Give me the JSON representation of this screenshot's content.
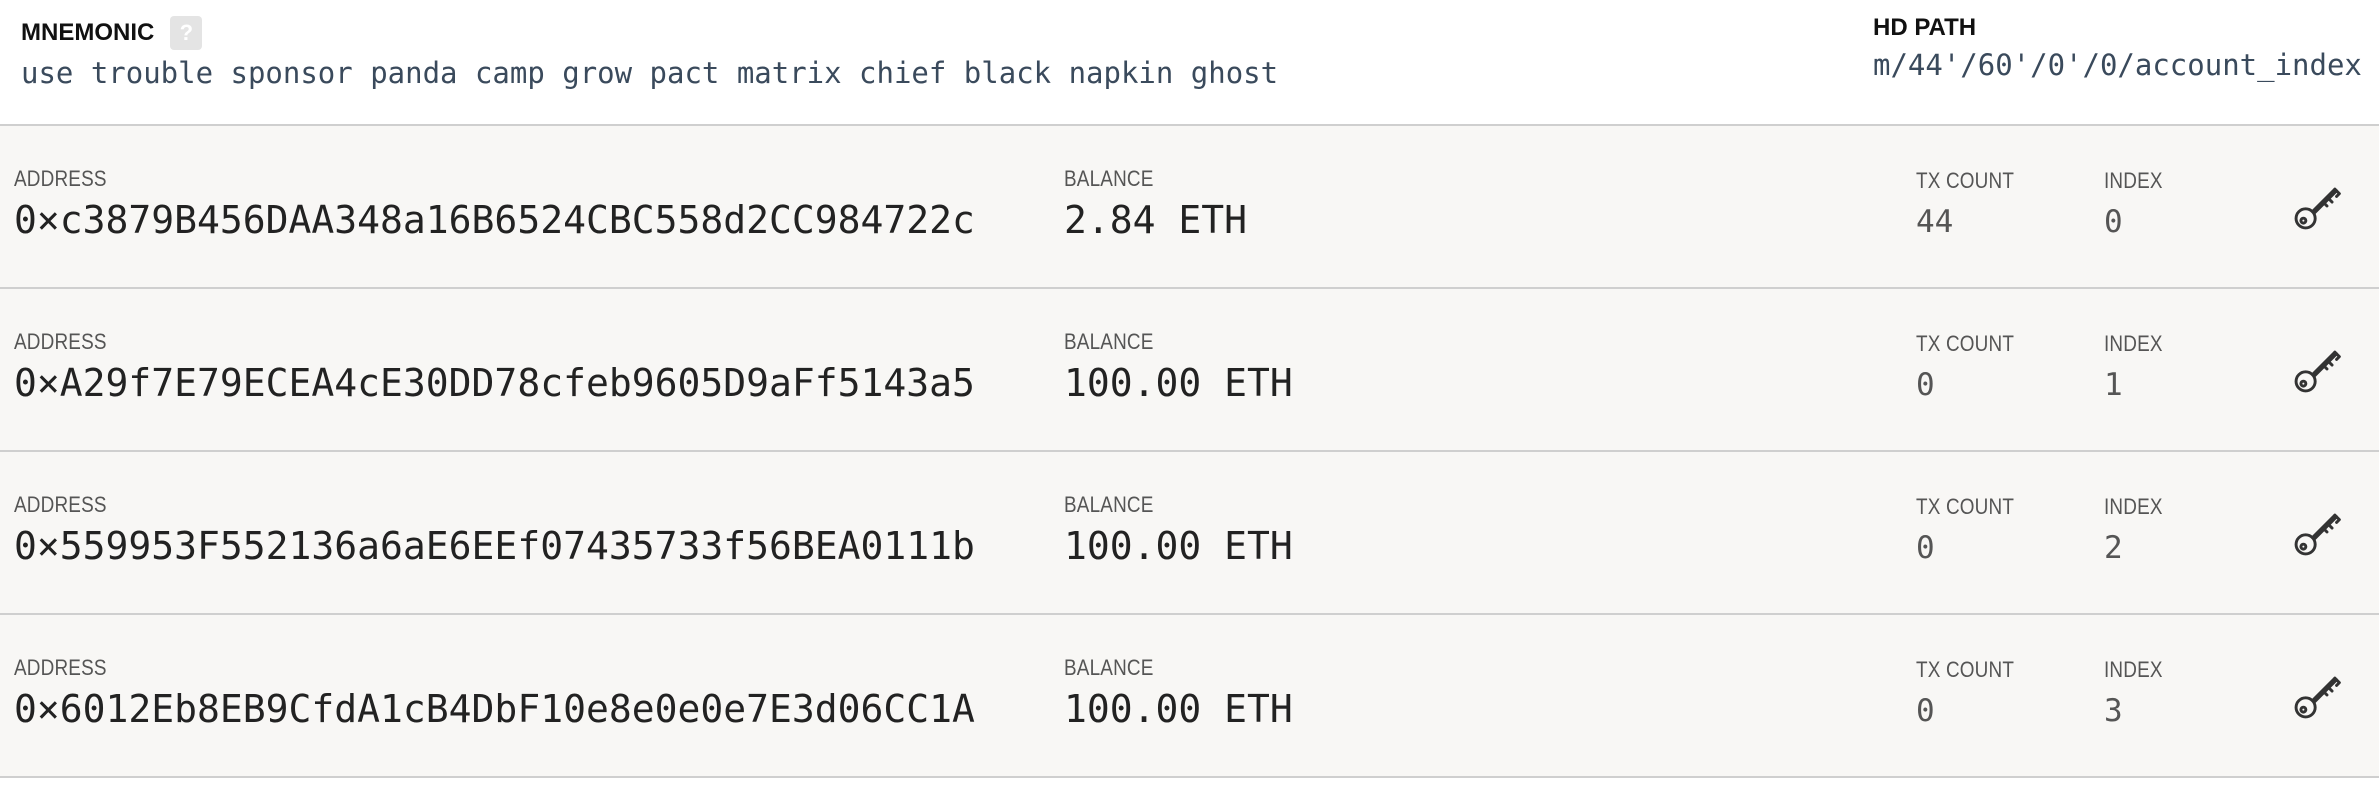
{
  "header": {
    "mnemonic_label": "MNEMONIC",
    "help_label": "?",
    "mnemonic": "use trouble sponsor panda camp grow pact matrix chief black napkin ghost",
    "hd_path_label": "HD PATH",
    "hd_path": "m/44'/60'/0'/0/account_index"
  },
  "labels": {
    "address": "ADDRESS",
    "balance": "BALANCE",
    "tx_count": "TX COUNT",
    "index": "INDEX"
  },
  "accounts": [
    {
      "address": "0×c3879B456DAA348a16B6524CBC558d2CC984722c",
      "balance": "2.84 ETH",
      "tx_count": "44",
      "index": "0"
    },
    {
      "address": "0×A29f7E79ECEA4cE30DD78cfeb9605D9aFf5143a5",
      "balance": "100.00 ETH",
      "tx_count": "0",
      "index": "1"
    },
    {
      "address": "0×559953F552136a6aE6EEf07435733f56BEA0111b",
      "balance": "100.00 ETH",
      "tx_count": "0",
      "index": "2"
    },
    {
      "address": "0×6012Eb8EB9CfdA1cB4DbF10e8e0e0e7E3d06CC1A",
      "balance": "100.00 ETH",
      "tx_count": "0",
      "index": "3"
    }
  ],
  "icons": {
    "help": "question-mark-icon",
    "show_keys": "key-icon"
  },
  "colors": {
    "row_background": "#f8f7f5",
    "divider": "#cfcfcf",
    "mnemonic_text": "#3a4a5c",
    "help_badge": "#e4e4e4"
  }
}
